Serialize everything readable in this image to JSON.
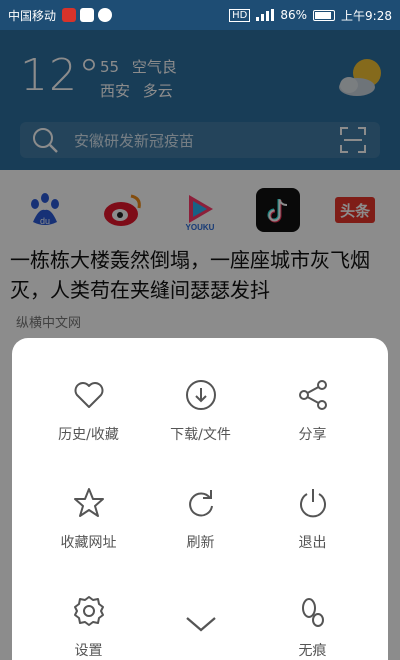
{
  "status_bar": {
    "carrier": "中国移动",
    "battery": "86%",
    "time": "上午9:28",
    "network": "HD"
  },
  "weather": {
    "temperature": "12°",
    "aqi_value": "55",
    "aqi_label": "空气良",
    "city": "西安",
    "condition": "多云",
    "icon": "cloud-sun-icon"
  },
  "search": {
    "placeholder": "安徽研发新冠疫苗"
  },
  "shortcuts": [
    {
      "name": "baidu",
      "icon": "baidu-icon",
      "color": "#2a5ad8"
    },
    {
      "name": "weibo",
      "icon": "weibo-icon",
      "color": "#e6162d"
    },
    {
      "name": "youku",
      "icon": "youku-icon",
      "color": "#ff3a6a"
    },
    {
      "name": "douyin",
      "icon": "tiktok-icon",
      "color": "#111111"
    },
    {
      "name": "toutiao",
      "icon": "toutiao-icon",
      "color": "#e8352b",
      "text": "头条"
    }
  ],
  "news": {
    "title": "一栋栋大楼轰然倒塌，一座座城市灰飞烟灭，人类苟在夹缝间瑟瑟发抖",
    "source": "纵横中文网"
  },
  "menu": {
    "items": [
      {
        "label": "历史/收藏",
        "icon": "heart-icon"
      },
      {
        "label": "下载/文件",
        "icon": "download-icon"
      },
      {
        "label": "分享",
        "icon": "share-icon"
      },
      {
        "label": "收藏网址",
        "icon": "star-icon"
      },
      {
        "label": "刷新",
        "icon": "refresh-icon"
      },
      {
        "label": "退出",
        "icon": "power-icon"
      },
      {
        "label": "设置",
        "icon": "gear-icon"
      },
      {
        "label": "",
        "icon": "chevron-down-icon"
      },
      {
        "label": "无痕",
        "icon": "footprint-icon"
      }
    ]
  }
}
